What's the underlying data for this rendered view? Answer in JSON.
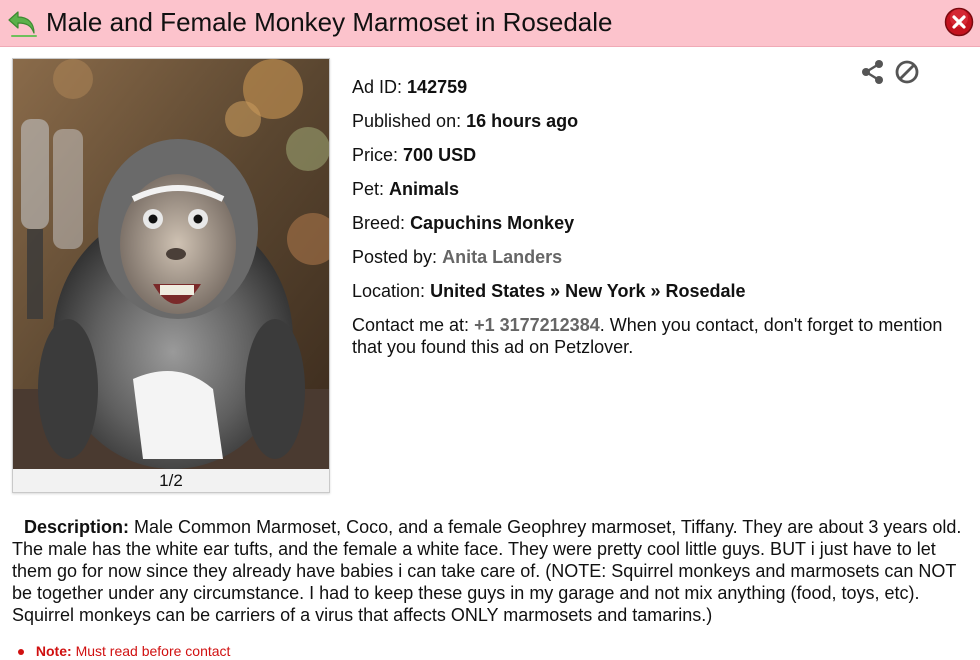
{
  "header": {
    "title": "Male and Female Monkey Marmoset in Rosedale",
    "back_icon": "back-arrow-icon",
    "close_icon": "close-icon",
    "colors": {
      "bar": "#fcc3cc",
      "close": "#c4121e",
      "back": "#5bb14a"
    }
  },
  "gallery": {
    "counter": "1/2",
    "image_alt": "Monkey photo"
  },
  "actions": {
    "share_icon": "share-icon",
    "block_icon": "block-icon"
  },
  "details": {
    "ad_id_label": "Ad ID:",
    "ad_id": "142759",
    "published_label": "Published on:",
    "published": "16 hours ago",
    "price_label": "Price:",
    "price": "700 USD",
    "pet_label": "Pet:",
    "pet": "Animals",
    "breed_label": "Breed:",
    "breed": "Capuchins Monkey",
    "posted_label": "Posted by:",
    "posted_by": "Anita Landers",
    "location_label": "Location:",
    "location": "United States » New York » Rosedale",
    "contact_label": "Contact me at:",
    "phone": "+1 3177212384",
    "contact_suffix": ". When you contact, don't forget to mention that you found this ad on Petzlover."
  },
  "description": {
    "label": "Description:",
    "text": "Male Common Marmoset, Coco, and a female Geophrey marmoset, Tiffany. They are about 3 years old. The male has the white ear tufts, and the female a white face. They were pretty cool little guys. BUT i just have to let them go for now since they already have babies i can take care of. (NOTE: Squirrel monkeys and marmosets can NOT be together under any circumstance. I had to keep these guys in my garage and not mix anything (food, toys, etc). Squirrel monkeys can be carriers of a virus that affects ONLY marmosets and tamarins.)"
  },
  "note": {
    "label": "Note:",
    "text": "Must read before contact"
  }
}
